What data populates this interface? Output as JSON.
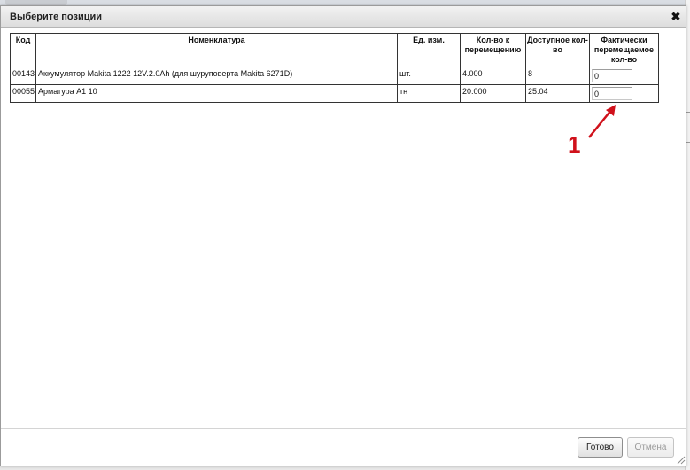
{
  "dialog": {
    "title": "Выберите позиции",
    "close_icon": "close-icon"
  },
  "table": {
    "headers": [
      "Код",
      "Номенклатура",
      "Ед. изм.",
      "Кол-во к перемещению",
      "Доступное кол-во",
      "Фактически перемещаемое кол-во"
    ],
    "rows": [
      {
        "code": "00143",
        "item": "Аккумулятор Makita 1222 12V.2.0Ah (для шуруповерта Makita 6271D)",
        "unit": "шт.",
        "qty_to_move": "4.000",
        "available": "8",
        "actual_qty": "0"
      },
      {
        "code": "00055",
        "item": "Арматура А1 10",
        "unit": "тн",
        "qty_to_move": "20.000",
        "available": "25.04",
        "actual_qty": "0"
      }
    ]
  },
  "annotation": {
    "label": "1",
    "color": "#d0111b"
  },
  "footer": {
    "ok_label": "Готово",
    "cancel_label": "Отмена"
  }
}
